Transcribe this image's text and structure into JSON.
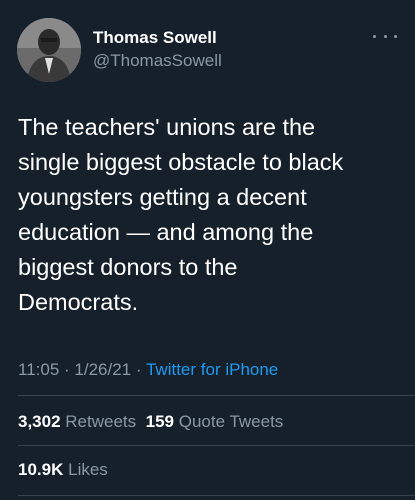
{
  "author": {
    "name": "Thomas Sowell",
    "handle": "@ThomasSowell"
  },
  "tweet": {
    "text_lines": [
      "The teachers' unions are the",
      "single biggest obstacle to black",
      "youngsters getting a decent",
      "education — and among the",
      "biggest donors to the",
      "Democrats."
    ],
    "time": "11:05",
    "date": "1/26/21",
    "separator": "·",
    "source": "Twitter for iPhone"
  },
  "stats": {
    "retweets_count": "3,302",
    "retweets_label": "Retweets",
    "quotes_count": "159",
    "quotes_label": "Quote Tweets",
    "likes_count": "10.9K",
    "likes_label": "Likes"
  },
  "colors": {
    "background": "#15202b",
    "text": "#ffffff",
    "secondary": "#8b98a5",
    "link": "#1d9bf0",
    "divider": "#38444d"
  },
  "icons": {
    "more": "more-horizontal-icon"
  }
}
